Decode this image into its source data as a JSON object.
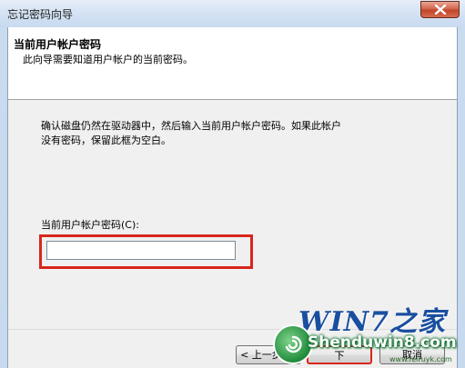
{
  "window": {
    "title": "忘记密码向导",
    "close_icon": "close-icon"
  },
  "header": {
    "title": "当前用户帐户密码",
    "subtitle": "此向导需要知道用户帐户的当前密码。"
  },
  "body": {
    "instruction_line1": "确认磁盘仍然在驱动器中，然后输入当前用户帐户密码。如果此帐户",
    "instruction_line2": "没有密码，保留此框为空白。",
    "field_label": "当前用户帐户密码(C):",
    "password_value": "",
    "password_placeholder": ""
  },
  "buttons": {
    "back_label": "< 上一步(B)",
    "next_label": "下",
    "cancel_label": "取消"
  },
  "watermark": {
    "logo_text": "WIN7之家",
    "site_text": "Shenduwin8.com",
    "small_text": "www.feiruyk.com"
  },
  "colors": {
    "highlight": "#d9261c",
    "title_bar": "#d4e2f3",
    "dialog_bg": "#f0f0f0"
  }
}
